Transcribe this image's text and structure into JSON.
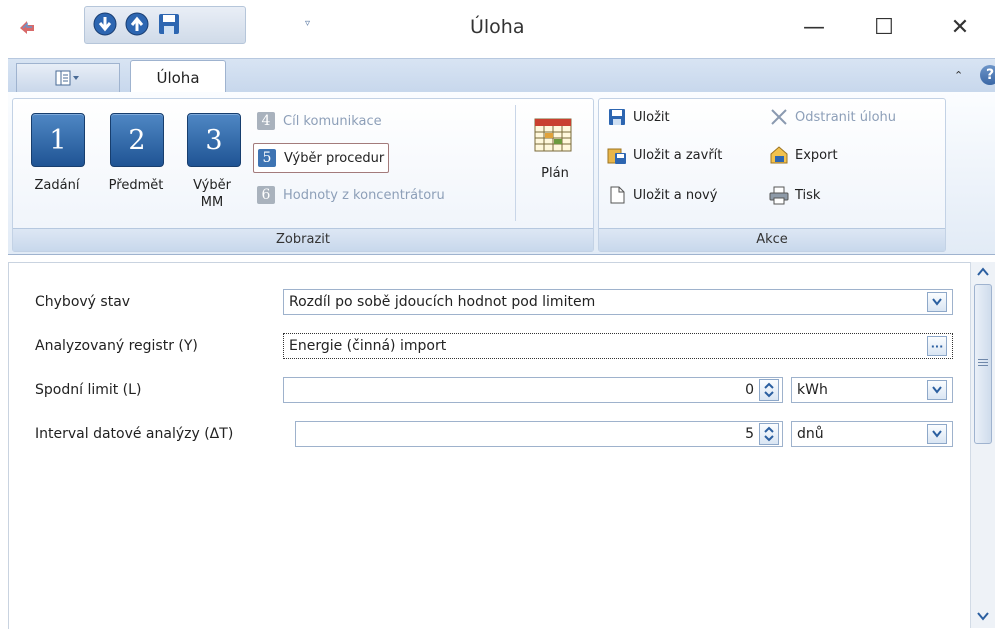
{
  "window": {
    "title": "Úloha",
    "qat_dropdown_glyph": "▿",
    "minimize_glyph": "—",
    "maximize_glyph": "☐",
    "close_glyph": "✕"
  },
  "ribbon": {
    "tabs": [
      {
        "label": "Úloha",
        "active": true
      }
    ],
    "minimize_glyph": "⌃",
    "help_glyph": "?",
    "groups": {
      "zobrazit": {
        "label": "Zobrazit",
        "big_buttons": [
          {
            "number": "1",
            "label": "Zadání"
          },
          {
            "number": "2",
            "label": "Předmět"
          },
          {
            "number": "3",
            "label": "Výběr MM"
          }
        ],
        "small_buttons": [
          {
            "number": "4",
            "label": "Cíl komunikace",
            "enabled": false
          },
          {
            "number": "5",
            "label": "Výběr procedur",
            "enabled": true
          },
          {
            "number": "6",
            "label": "Hodnoty z koncentrátoru",
            "enabled": false
          }
        ],
        "plan_label": "Plán"
      },
      "akce": {
        "label": "Akce",
        "save_label": "Uložit",
        "save_close_label": "Uložit a zavřít",
        "save_new_label": "Uložit a nový",
        "delete_label": "Odstranit úlohu",
        "export_label": "Export",
        "print_label": "Tisk"
      }
    }
  },
  "form": {
    "fault_state": {
      "label": "Chybový stav",
      "value": "Rozdíl po sobě jdoucích hodnot pod limitem"
    },
    "register": {
      "label": "Analyzovaný registr (Y)",
      "value": "Energie (činná) import",
      "button_glyph": "···"
    },
    "lower_limit": {
      "label": "Spodní limit (L)",
      "value": "0",
      "unit": "kWh"
    },
    "interval": {
      "label": "Interval datové analýzy (ΔT)",
      "value": "5",
      "unit": "dnů"
    }
  },
  "colors": {
    "accent_blue": "#2a5f9e",
    "ribbon_bg": "#dfe8f4",
    "disabled_text": "#8d9fb8"
  }
}
